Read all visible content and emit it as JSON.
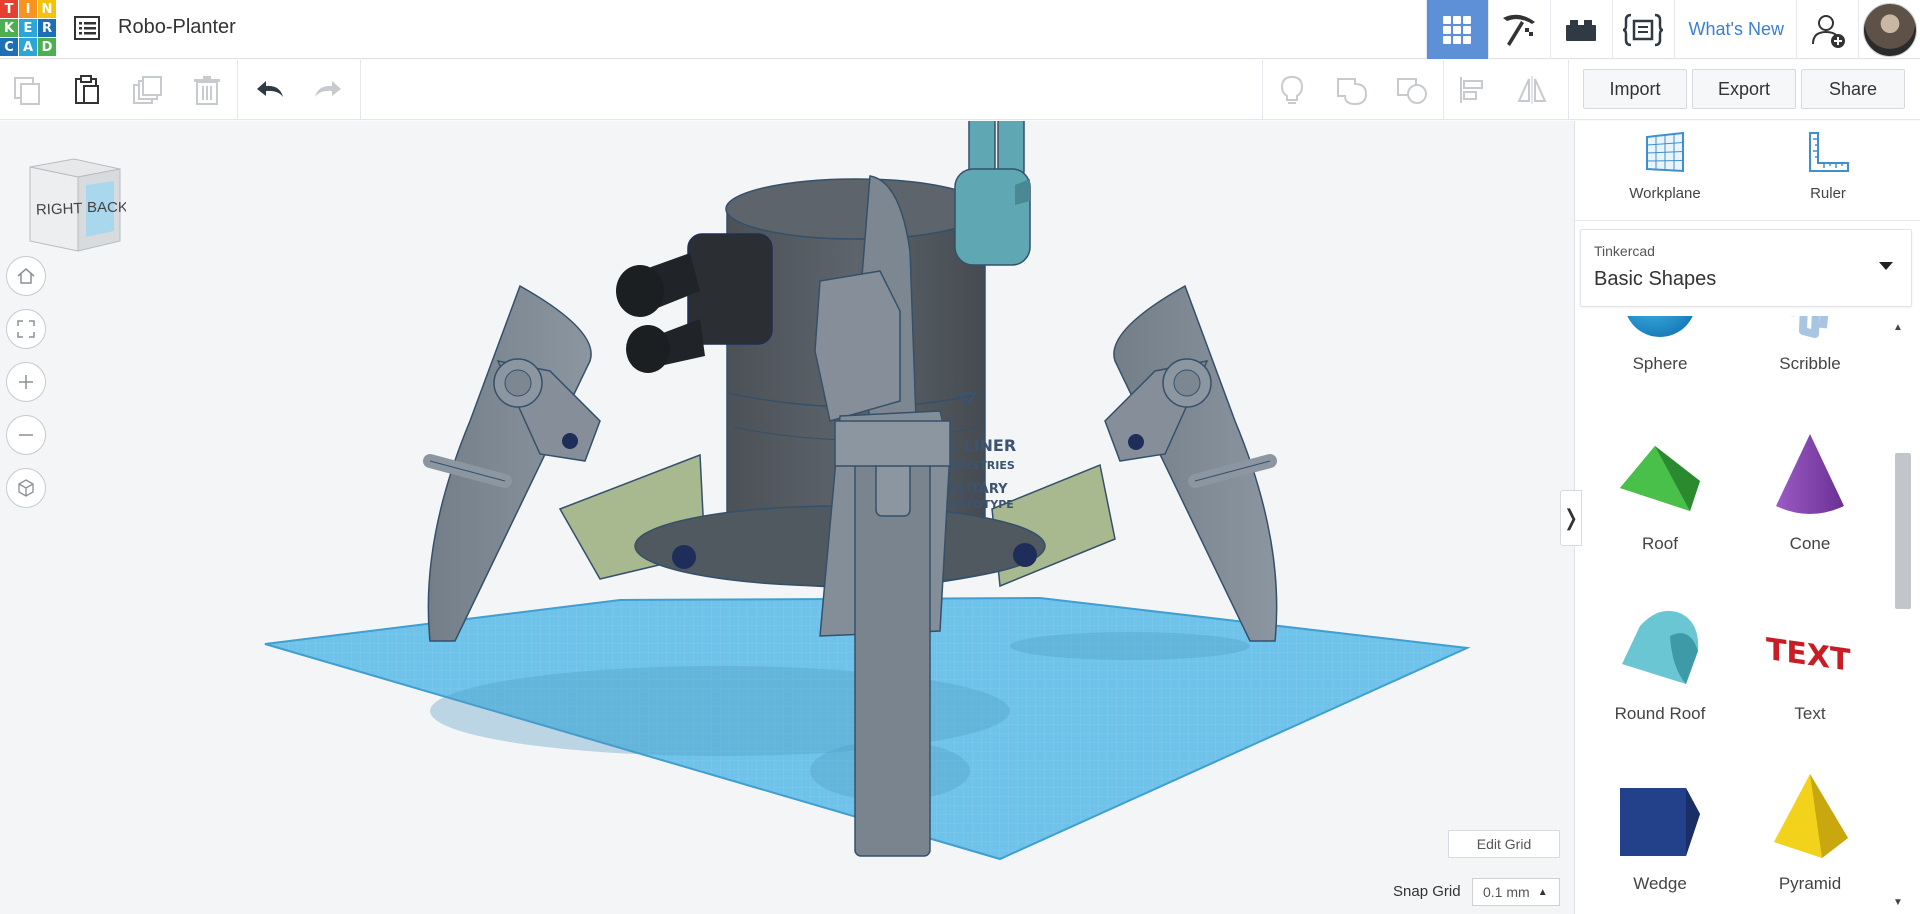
{
  "app": {
    "logo_letters": [
      "T",
      "I",
      "N",
      "K",
      "E",
      "R",
      "C",
      "A",
      "D"
    ],
    "project_title": "Robo-Planter",
    "whats_new": "What's New"
  },
  "toolbar": {
    "import_label": "Import",
    "export_label": "Export",
    "share_label": "Share"
  },
  "viewcube": {
    "right_face": "RIGHT",
    "back_face": "BACK"
  },
  "model_labels": {
    "line1": "C. LINER",
    "line2": "INDUSTRIES",
    "line3": "MILITARY",
    "line4": "PROTOTYPE"
  },
  "viewport": {
    "edit_grid_label": "Edit Grid",
    "snap_grid_label": "Snap Grid",
    "snap_grid_value": "0.1 mm"
  },
  "panel": {
    "workplane_label": "Workplane",
    "ruler_label": "Ruler",
    "library_provider": "Tinkercad",
    "library_name": "Basic Shapes",
    "shapes": [
      {
        "label": "Sphere"
      },
      {
        "label": "Scribble"
      },
      {
        "label": "Roof"
      },
      {
        "label": "Cone"
      },
      {
        "label": "Round Roof"
      },
      {
        "label": "Text"
      },
      {
        "label": "Wedge"
      },
      {
        "label": "Pyramid"
      }
    ],
    "text_shape_word": "TEXT"
  },
  "colors": {
    "nav_active": "#5e90d8",
    "link_blue": "#3c7fd0",
    "workplane_blue": "#5ab8e4",
    "model_gray": "#808a94",
    "model_green": "#a9b98f",
    "model_teal": "#5fa7b2"
  }
}
